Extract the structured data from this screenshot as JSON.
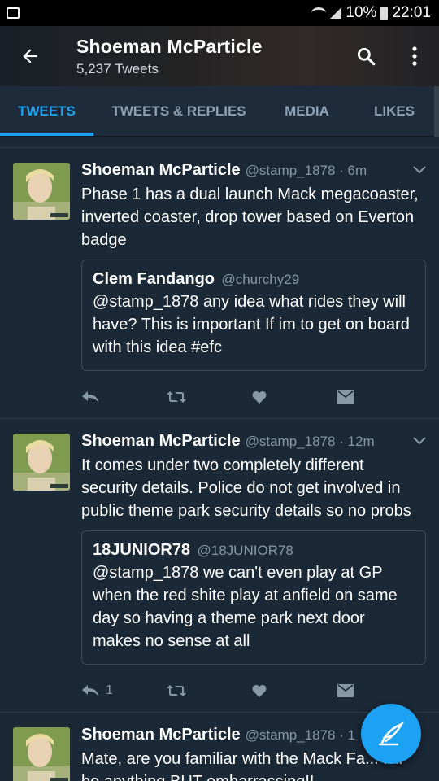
{
  "status": {
    "battery": "10%",
    "time": "22:01"
  },
  "header": {
    "title": "Shoeman McParticle",
    "subtitle": "5,237 Tweets"
  },
  "tabs": [
    "TWEETS",
    "TWEETS & REPLIES",
    "MEDIA",
    "LIKES"
  ],
  "tweets": [
    {
      "name": "Shoeman McParticle",
      "meta": "@stamp_1878 · 6m",
      "text": "Phase 1 has a dual launch Mack megacoaster, inverted coaster, drop tower based on Everton badge",
      "quote": {
        "name": "Clem Fandango",
        "handle": "@churchy29",
        "text": "@stamp_1878 any idea what rides they will have? This is important If im to get on board with this idea #efc"
      },
      "reply_count": ""
    },
    {
      "name": "Shoeman McParticle",
      "meta": "@stamp_1878 · 12m",
      "text": "It comes under two completely different security details. Police do not get involved in public theme park security details so no probs",
      "quote": {
        "name": "18JUNIOR78",
        "handle": "@18JUNIOR78",
        "text": "@stamp_1878 we can't even play at GP when the red shite play at anfield on same day so having a theme park next door makes no sense at all"
      },
      "reply_count": "1"
    },
    {
      "name": "Shoeman McParticle",
      "meta": "@stamp_1878 · 1",
      "text": "Mate, are you familiar with the Mack Fa... It'll be anything BUT embarrassing!!"
    }
  ],
  "colors": {
    "accent": "#1da1f2",
    "background": "#1b2836"
  },
  "icons": [
    "back-arrow-icon",
    "search-icon",
    "more-vert-icon",
    "reply-icon",
    "retweet-icon",
    "like-icon",
    "message-icon",
    "compose-icon",
    "chevron-down-icon"
  ]
}
